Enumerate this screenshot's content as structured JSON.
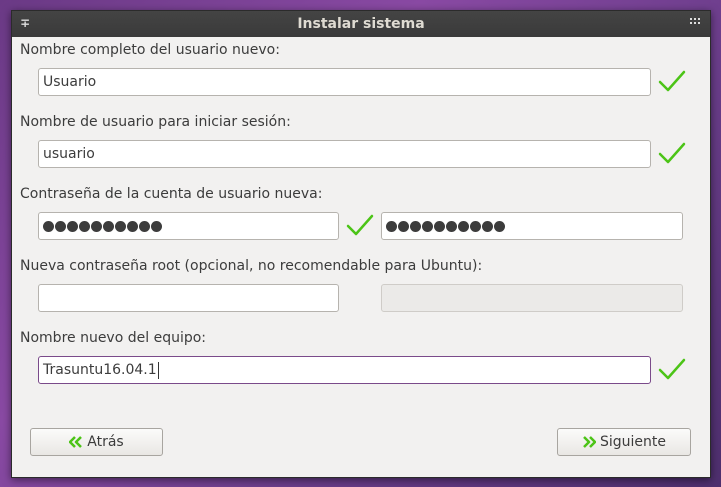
{
  "window": {
    "title": "Instalar sistema"
  },
  "form": {
    "fullname_label": "Nombre completo del usuario nuevo:",
    "fullname_value": "Usuario",
    "username_label": "Nombre de usuario para iniciar sesión:",
    "username_value": "usuario",
    "password_label": "Contraseña de la cuenta de usuario nueva:",
    "password_dots": 10,
    "password_confirm_dots": 10,
    "root_label": "Nueva contraseña root (opcional, no recomendable para Ubuntu):",
    "root_value": "",
    "hostname_label": "Nombre nuevo del equipo:",
    "hostname_value": "Trasuntu16.04.1"
  },
  "buttons": {
    "back_label": "Atrás",
    "next_label": "Siguiente"
  },
  "colors": {
    "accent": "#7a4a8a",
    "check": "#4cc417",
    "chevron": "#4cc417"
  }
}
